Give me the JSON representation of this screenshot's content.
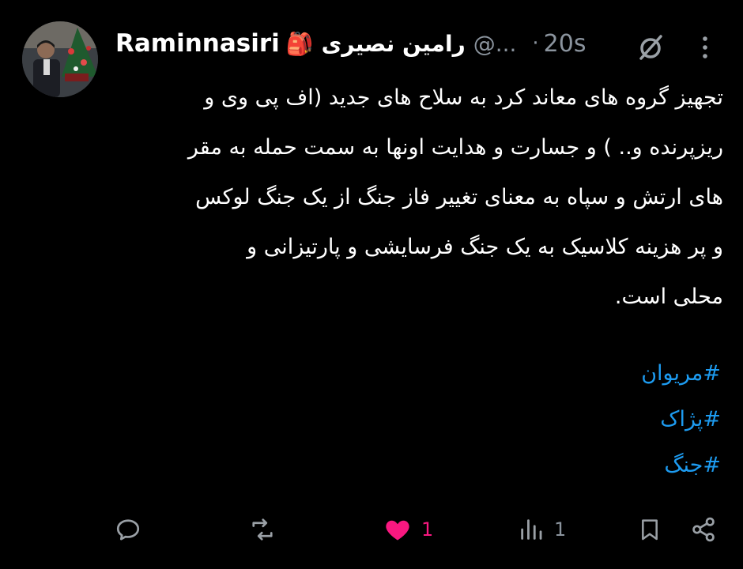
{
  "author": {
    "display_name": "Raminnasiri",
    "badge_emoji": "🎒",
    "name_fa": "رامین نصیری",
    "handle": "@...",
    "separator": "·",
    "time": "20s",
    "avatar": "avatar-photo-christmas-tree"
  },
  "header_icons": {
    "grok": "grok-slash-icon",
    "more": "more-vertical-icon"
  },
  "tweet": {
    "text": "تجهیز گروه های معاند کرد به سلاح های جدید (اف پی وی و\nریزپرنده و.. ) و جسارت و هدایت اونها به سمت حمله به مقر\nهای ارتش و سپاه به معنای تغییر فاز جنگ از یک جنگ لوکس\nو پر هزینه کلاسیک به یک جنگ فرسایشی و پارتیزانی و\nمحلی است.",
    "hashtags": [
      "#مریوان",
      "#پژاک",
      "#جنگ"
    ]
  },
  "actions": {
    "reply_icon": "reply-icon",
    "retweet_icon": "retweet-icon",
    "like_icon": "heart-filled-icon",
    "like_count": "1",
    "views_icon": "views-bar-chart-icon",
    "views_count": "1",
    "bookmark_icon": "bookmark-icon",
    "share_icon": "share-icon"
  },
  "colors": {
    "background": "#000000",
    "text": "#ffffff",
    "muted": "#8b949e",
    "link": "#1d9bf0",
    "like": "#f91880"
  }
}
